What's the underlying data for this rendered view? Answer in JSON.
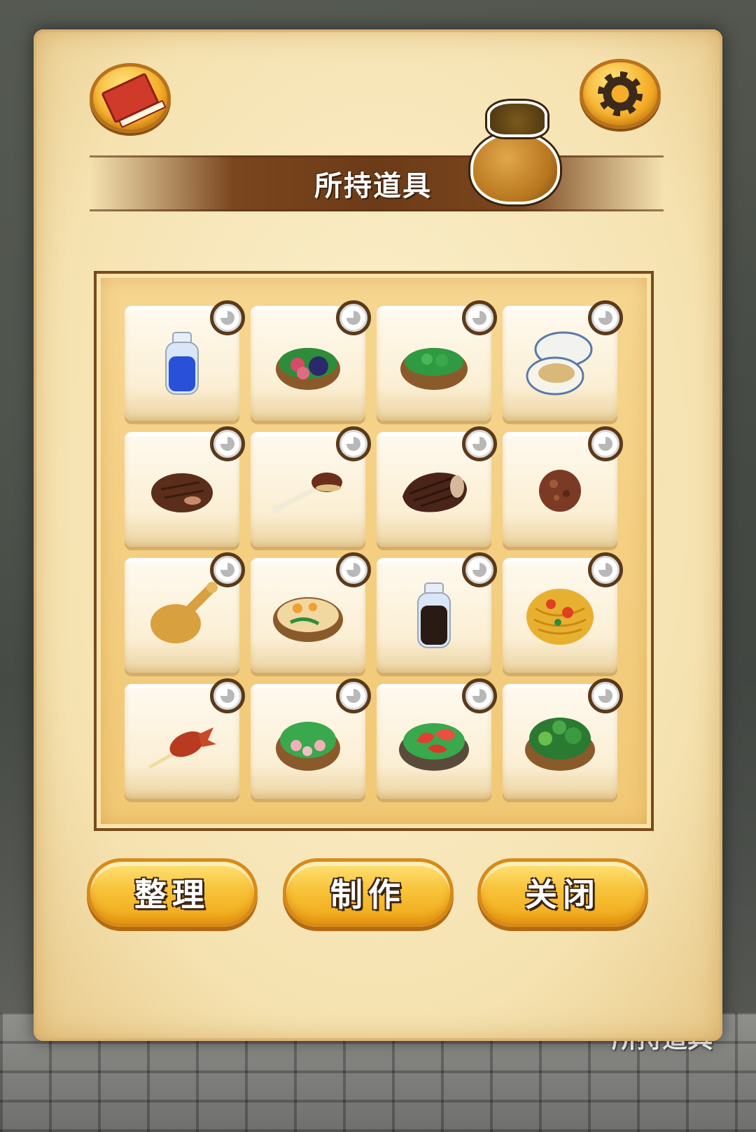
{
  "scene": {
    "background_label": "所持道具"
  },
  "panel": {
    "title": "所持道具",
    "buttons": {
      "book_icon": "book-icon",
      "settings_icon": "gear-icon",
      "bag_icon": "bag-icon"
    }
  },
  "inventory": {
    "items": [
      {
        "icon": "blue-potion-icon"
      },
      {
        "icon": "vegetable-bowl-icon"
      },
      {
        "icon": "green-paste-bowl-icon"
      },
      {
        "icon": "clam-icon"
      },
      {
        "icon": "grilled-steak-icon"
      },
      {
        "icon": "meat-on-bone-icon"
      },
      {
        "icon": "large-steak-icon"
      },
      {
        "icon": "meatball-icon"
      },
      {
        "icon": "fried-chicken-leg-icon"
      },
      {
        "icon": "stew-bowl-icon"
      },
      {
        "icon": "dark-sauce-bottle-icon"
      },
      {
        "icon": "pasta-plate-icon"
      },
      {
        "icon": "grilled-squid-skewer-icon"
      },
      {
        "icon": "octopus-salad-icon"
      },
      {
        "icon": "shrimp-bowl-icon"
      },
      {
        "icon": "greens-bowl-icon"
      }
    ]
  },
  "actions": {
    "sort_label": "整理",
    "craft_label": "制作",
    "close_label": "关闭"
  },
  "colors": {
    "accent": "#f5ae29",
    "parchment": "#f5e2b0",
    "banner": "#6c3b17"
  }
}
